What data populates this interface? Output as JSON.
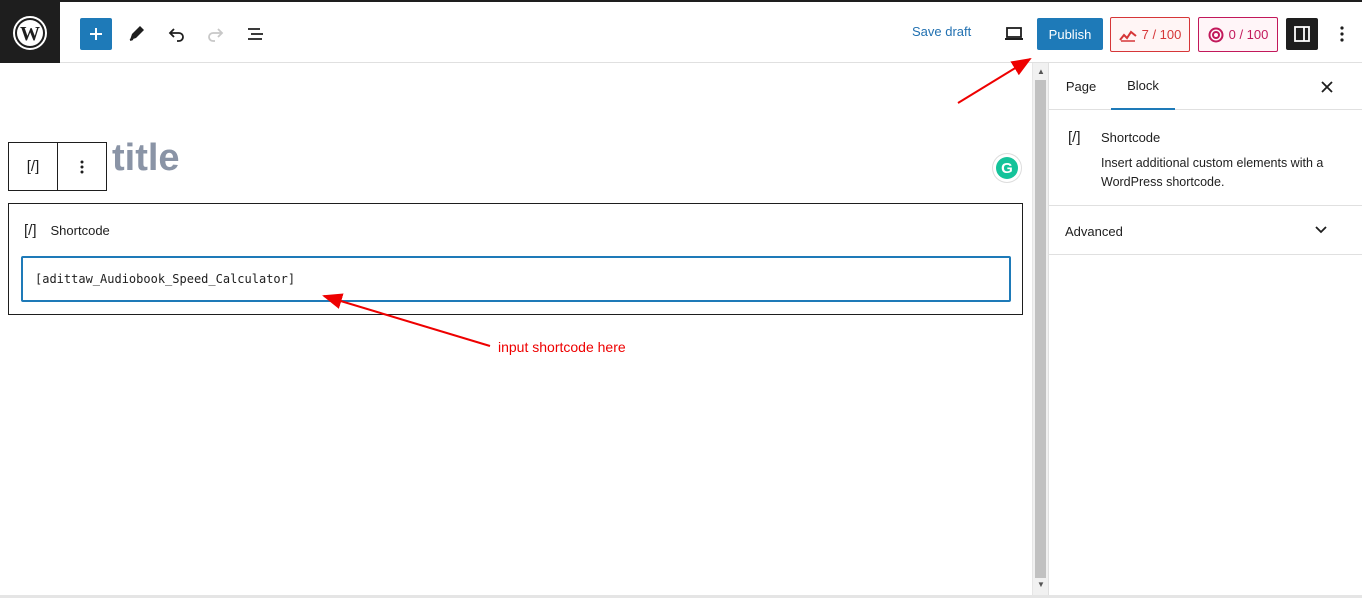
{
  "toolbar": {
    "save_draft_label": "Save draft",
    "publish_label": "Publish",
    "seo_score": "7 / 100",
    "readability_score": "0 / 100"
  },
  "editor": {
    "title_placeholder_visible": "title",
    "block_toolbar_icon": "[/]",
    "shortcode_block": {
      "icon": "[/]",
      "label": "Shortcode",
      "value": "[adittaw_Audiobook_Speed_Calculator]"
    },
    "annotation": "input shortcode here"
  },
  "sidebar": {
    "tabs": [
      {
        "label": "Page"
      },
      {
        "label": "Block"
      }
    ],
    "block_card": {
      "icon": "[/]",
      "name": "Shortcode",
      "description": "Insert additional custom elements with a WordPress shortcode."
    },
    "advanced_label": "Advanced"
  },
  "colors": {
    "accent": "#1e7ab8",
    "dark": "#1e1e1e",
    "annotation_red": "#e00000"
  }
}
